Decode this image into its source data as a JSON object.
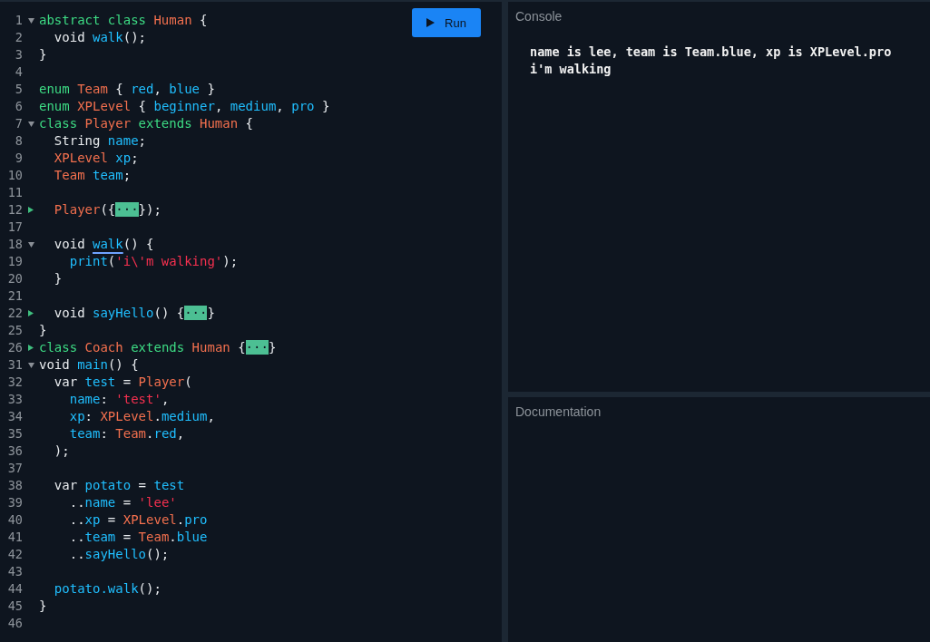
{
  "editor": {
    "run_button": {
      "label": "Run"
    },
    "lines": [
      {
        "number": "1",
        "expanded": true,
        "tokens": [
          {
            "kind": "keyword",
            "text": "abstract class "
          },
          {
            "kind": "type",
            "text": "Human"
          },
          {
            "kind": "plain",
            "text": " {"
          }
        ]
      },
      {
        "number": "2",
        "tokens": [
          {
            "kind": "plain",
            "text": "  void "
          },
          {
            "kind": "name",
            "text": "walk"
          },
          {
            "kind": "plain",
            "text": "();"
          }
        ]
      },
      {
        "number": "3",
        "tokens": [
          {
            "kind": "plain",
            "text": "}"
          }
        ]
      },
      {
        "number": "4"
      },
      {
        "number": "5",
        "tokens": [
          {
            "kind": "keyword",
            "text": "enum "
          },
          {
            "kind": "type",
            "text": "Team"
          },
          {
            "kind": "plain",
            "text": " { "
          },
          {
            "kind": "name",
            "text": "red"
          },
          {
            "kind": "plain",
            "text": ", "
          },
          {
            "kind": "name",
            "text": "blue"
          },
          {
            "kind": "plain",
            "text": " }"
          }
        ]
      },
      {
        "number": "6",
        "tokens": [
          {
            "kind": "keyword",
            "text": "enum "
          },
          {
            "kind": "type",
            "text": "XPLevel"
          },
          {
            "kind": "plain",
            "text": " { "
          },
          {
            "kind": "name",
            "text": "beginner"
          },
          {
            "kind": "plain",
            "text": ", "
          },
          {
            "kind": "name",
            "text": "medium"
          },
          {
            "kind": "plain",
            "text": ", "
          },
          {
            "kind": "name",
            "text": "pro"
          },
          {
            "kind": "plain",
            "text": " }"
          }
        ]
      },
      {
        "number": "7",
        "expanded": true,
        "tokens": [
          {
            "kind": "keyword",
            "text": "class "
          },
          {
            "kind": "type",
            "text": "Player"
          },
          {
            "kind": "keyword",
            "text": " extends "
          },
          {
            "kind": "type",
            "text": "Human"
          },
          {
            "kind": "plain",
            "text": " {"
          }
        ]
      },
      {
        "number": "8",
        "tokens": [
          {
            "kind": "plain",
            "text": "  String "
          },
          {
            "kind": "name",
            "text": "name"
          },
          {
            "kind": "plain",
            "text": ";"
          }
        ]
      },
      {
        "number": "9",
        "tokens": [
          {
            "kind": "type",
            "text": "  XPLevel"
          },
          {
            "kind": "name",
            "text": " xp"
          },
          {
            "kind": "plain",
            "text": ";"
          }
        ]
      },
      {
        "number": "10",
        "tokens": [
          {
            "kind": "type",
            "text": "  Team"
          },
          {
            "kind": "name",
            "text": " team"
          },
          {
            "kind": "plain",
            "text": ";"
          }
        ]
      },
      {
        "number": "11"
      },
      {
        "number": "12",
        "expanded": false,
        "tokens": [
          {
            "kind": "type",
            "text": "  Player"
          },
          {
            "kind": "plain",
            "text": "({"
          },
          {
            "kind": "folded",
            "text": "···"
          },
          {
            "kind": "plain",
            "text": "});"
          }
        ]
      },
      {
        "number": "17"
      },
      {
        "number": "18",
        "expanded": true,
        "tokens": [
          {
            "kind": "plain",
            "text": "  void "
          },
          {
            "kind": "underlined",
            "text": "walk"
          },
          {
            "kind": "plain",
            "text": "() {"
          }
        ]
      },
      {
        "number": "19",
        "tokens": [
          {
            "kind": "name",
            "text": "    print"
          },
          {
            "kind": "plain",
            "text": "("
          },
          {
            "kind": "string",
            "text": "'i\\'m walking'"
          },
          {
            "kind": "plain",
            "text": ");"
          }
        ]
      },
      {
        "number": "20",
        "tokens": [
          {
            "kind": "plain",
            "text": "  }"
          }
        ]
      },
      {
        "number": "21"
      },
      {
        "number": "22",
        "expanded": false,
        "tokens": [
          {
            "kind": "plain",
            "text": "  void "
          },
          {
            "kind": "name",
            "text": "sayHello"
          },
          {
            "kind": "plain",
            "text": "() {"
          },
          {
            "kind": "folded",
            "text": "···"
          },
          {
            "kind": "plain",
            "text": "}"
          }
        ]
      },
      {
        "number": "25",
        "tokens": [
          {
            "kind": "plain",
            "text": "}"
          }
        ]
      },
      {
        "number": "26",
        "expanded": false,
        "tokens": [
          {
            "kind": "keyword",
            "text": "class "
          },
          {
            "kind": "type",
            "text": "Coach"
          },
          {
            "kind": "keyword",
            "text": " extends "
          },
          {
            "kind": "type",
            "text": "Human"
          },
          {
            "kind": "plain",
            "text": " {"
          },
          {
            "kind": "folded",
            "text": "···"
          },
          {
            "kind": "plain",
            "text": "}"
          }
        ]
      },
      {
        "number": "31",
        "expanded": true,
        "tokens": [
          {
            "kind": "plain",
            "text": "void "
          },
          {
            "kind": "name",
            "text": "main"
          },
          {
            "kind": "plain",
            "text": "() {"
          }
        ]
      },
      {
        "number": "32",
        "tokens": [
          {
            "kind": "plain",
            "text": "  var "
          },
          {
            "kind": "name",
            "text": "test"
          },
          {
            "kind": "plain",
            "text": " = "
          },
          {
            "kind": "type",
            "text": "Player"
          },
          {
            "kind": "plain",
            "text": "("
          }
        ]
      },
      {
        "number": "33",
        "tokens": [
          {
            "kind": "name",
            "text": "    name"
          },
          {
            "kind": "plain",
            "text": ": "
          },
          {
            "kind": "string",
            "text": "'test'"
          },
          {
            "kind": "plain",
            "text": ","
          }
        ]
      },
      {
        "number": "34",
        "tokens": [
          {
            "kind": "name",
            "text": "    xp"
          },
          {
            "kind": "plain",
            "text": ": "
          },
          {
            "kind": "type",
            "text": "XPLevel"
          },
          {
            "kind": "plain",
            "text": "."
          },
          {
            "kind": "name",
            "text": "medium"
          },
          {
            "kind": "plain",
            "text": ","
          }
        ]
      },
      {
        "number": "35",
        "tokens": [
          {
            "kind": "name",
            "text": "    team"
          },
          {
            "kind": "plain",
            "text": ": "
          },
          {
            "kind": "type",
            "text": "Team"
          },
          {
            "kind": "plain",
            "text": "."
          },
          {
            "kind": "name",
            "text": "red"
          },
          {
            "kind": "plain",
            "text": ","
          }
        ]
      },
      {
        "number": "36",
        "tokens": [
          {
            "kind": "plain",
            "text": "  );"
          }
        ]
      },
      {
        "number": "37"
      },
      {
        "number": "38",
        "tokens": [
          {
            "kind": "plain",
            "text": "  var "
          },
          {
            "kind": "name",
            "text": "potato"
          },
          {
            "kind": "plain",
            "text": " = "
          },
          {
            "kind": "name",
            "text": "test"
          }
        ]
      },
      {
        "number": "39",
        "tokens": [
          {
            "kind": "plain",
            "text": "    .."
          },
          {
            "kind": "name",
            "text": "name"
          },
          {
            "kind": "plain",
            "text": " = "
          },
          {
            "kind": "string",
            "text": "'lee'"
          }
        ]
      },
      {
        "number": "40",
        "tokens": [
          {
            "kind": "plain",
            "text": "    .."
          },
          {
            "kind": "name",
            "text": "xp"
          },
          {
            "kind": "plain",
            "text": " = "
          },
          {
            "kind": "type",
            "text": "XPLevel"
          },
          {
            "kind": "plain",
            "text": "."
          },
          {
            "kind": "name",
            "text": "pro"
          }
        ]
      },
      {
        "number": "41",
        "tokens": [
          {
            "kind": "plain",
            "text": "    .."
          },
          {
            "kind": "name",
            "text": "team"
          },
          {
            "kind": "plain",
            "text": " = "
          },
          {
            "kind": "type",
            "text": "Team"
          },
          {
            "kind": "plain",
            "text": "."
          },
          {
            "kind": "name",
            "text": "blue"
          }
        ]
      },
      {
        "number": "42",
        "tokens": [
          {
            "kind": "plain",
            "text": "    .."
          },
          {
            "kind": "name",
            "text": "sayHello"
          },
          {
            "kind": "plain",
            "text": "();"
          }
        ]
      },
      {
        "number": "43"
      },
      {
        "number": "44",
        "tokens": [
          {
            "kind": "name",
            "text": "  potato.walk"
          },
          {
            "kind": "plain",
            "text": "();"
          }
        ]
      },
      {
        "number": "45",
        "tokens": [
          {
            "kind": "plain",
            "text": "}"
          }
        ]
      },
      {
        "number": "46"
      }
    ]
  },
  "console": {
    "title": "Console",
    "output": [
      "name is lee, team is Team.blue, xp is XPLevel.pro",
      "i'm walking"
    ]
  },
  "documentation": {
    "title": "Documentation"
  }
}
